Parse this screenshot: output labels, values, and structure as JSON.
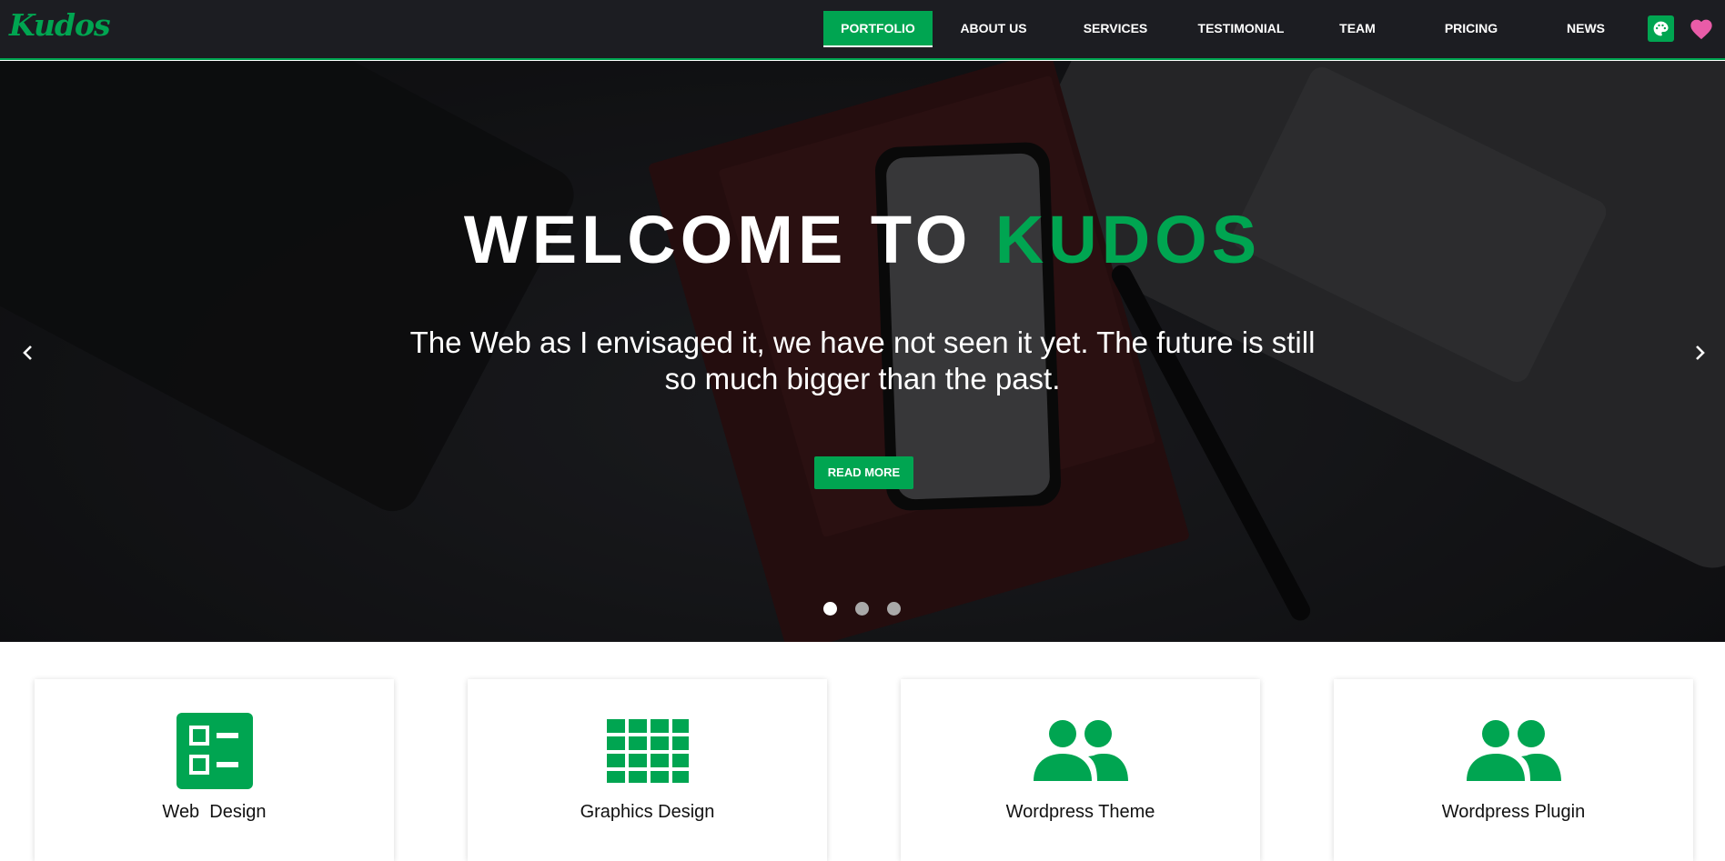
{
  "header": {
    "logo": "Kudos",
    "nav": [
      {
        "label": "PORTFOLIO",
        "active": true
      },
      {
        "label": "ABOUT US",
        "active": false
      },
      {
        "label": "SERVICES",
        "active": false
      },
      {
        "label": "TESTIMONIAL",
        "active": false
      },
      {
        "label": "TEAM",
        "active": false
      },
      {
        "label": "PRICING",
        "active": false
      },
      {
        "label": "NEWS",
        "active": false
      }
    ],
    "icons": [
      "palette-icon",
      "heart-icon"
    ]
  },
  "hero": {
    "title_white": "WELCOME TO",
    "title_accent": "KUDOS",
    "subtitle": "The Web as I envisaged it, we have not seen it yet. The future is still so much bigger than the past.",
    "button": "READ MORE",
    "slides": 3,
    "active_slide": 1
  },
  "services": [
    {
      "label": "Web  Design",
      "icon": "list-layout-icon"
    },
    {
      "label": "Graphics Design",
      "icon": "grid-icon"
    },
    {
      "label": "Wordpress Theme",
      "icon": "people-icon"
    },
    {
      "label": "Wordpress Plugin",
      "icon": "people-icon"
    }
  ],
  "colors": {
    "accent": "#00a551",
    "navbar_bg": "#1c1d22",
    "heart": "#e95ca8"
  }
}
